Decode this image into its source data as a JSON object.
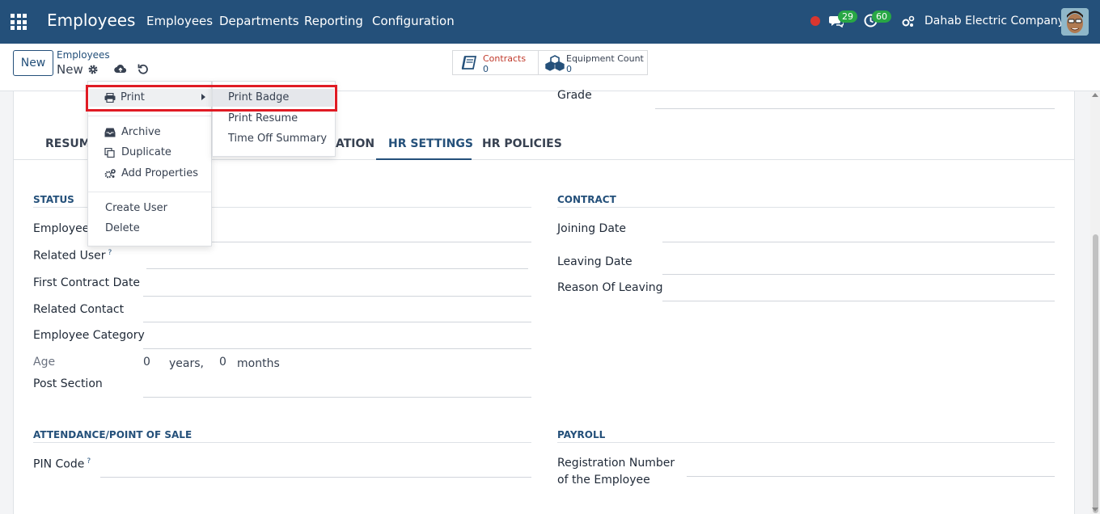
{
  "navbar": {
    "app_title": "Employees",
    "menus": [
      "Employees",
      "Departments",
      "Reporting",
      "Configuration"
    ],
    "messages_count": "29",
    "activities_count": "60",
    "company": "Dahab Electric Company",
    "accent": "#24507a"
  },
  "control": {
    "new_label": "New",
    "breadcrumb_parent": "Employees",
    "breadcrumb_current": "New",
    "smart_buttons": [
      {
        "label": "Contracts",
        "value": "0",
        "icon": "book-icon"
      },
      {
        "label": "Equipment Count",
        "value": "0",
        "icon": "cubes-icon"
      }
    ]
  },
  "top_field": {
    "label": "Grade"
  },
  "tabs": [
    {
      "label": "RESUME"
    },
    {
      "label": "ATION"
    },
    {
      "label": "HR SETTINGS",
      "active": true
    },
    {
      "label": "HR POLICIES"
    }
  ],
  "status": {
    "title": "STATUS",
    "fields": {
      "employee": "Employee",
      "related_user": "Related User",
      "first_contract_date": "First Contract Date",
      "related_contact": "Related Contact",
      "employee_category": "Employee Category",
      "age": "Age",
      "post_section": "Post Section"
    },
    "age_years_value": "0",
    "age_years_unit": "years,",
    "age_months_value": "0",
    "age_months_unit": "months",
    "help_mark": "?"
  },
  "contract": {
    "title": "CONTRACT",
    "fields": {
      "joining_date": "Joining Date",
      "leaving_date": "Leaving Date",
      "reason_of_leaving": "Reason Of Leaving"
    }
  },
  "attendance": {
    "title": "ATTENDANCE/POINT OF SALE",
    "pin_code": "PIN Code",
    "help_mark": "?"
  },
  "payroll": {
    "title": "PAYROLL",
    "registration_line1": "Registration Number",
    "registration_line2": "of the Employee"
  },
  "gear_menu": {
    "print": "Print",
    "archive": "Archive",
    "duplicate": "Duplicate",
    "add_properties": "Add Properties",
    "create_user": "Create User",
    "delete": "Delete"
  },
  "print_submenu": {
    "print_badge": "Print Badge",
    "print_resume": "Print Resume",
    "time_off_summary": "Time Off Summary"
  }
}
